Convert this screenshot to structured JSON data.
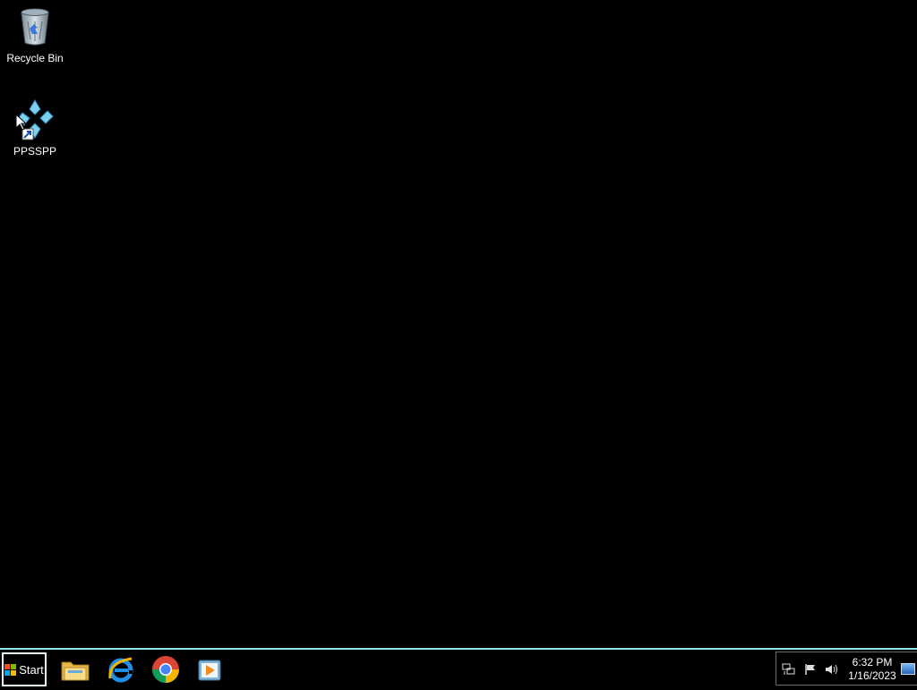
{
  "desktop": {
    "icons": [
      {
        "label": "Recycle Bin",
        "icon": "recycle-bin-icon"
      },
      {
        "label": "PPSSPP",
        "icon": "ppsspp-icon"
      }
    ]
  },
  "taskbar": {
    "start_label": "Start",
    "pinned_apps": [
      {
        "name": "File Explorer",
        "icon": "folder-icon"
      },
      {
        "name": "Internet Explorer",
        "icon": "ie-icon"
      },
      {
        "name": "Google Chrome",
        "icon": "chrome-icon"
      },
      {
        "name": "Windows Media Player",
        "icon": "media-player-icon"
      }
    ],
    "tray": {
      "icons": [
        "network-icon",
        "flag-icon",
        "volume-icon"
      ],
      "time": "6:32 PM",
      "date": "1/16/2023"
    },
    "accent_color": "#8fe6e6"
  }
}
